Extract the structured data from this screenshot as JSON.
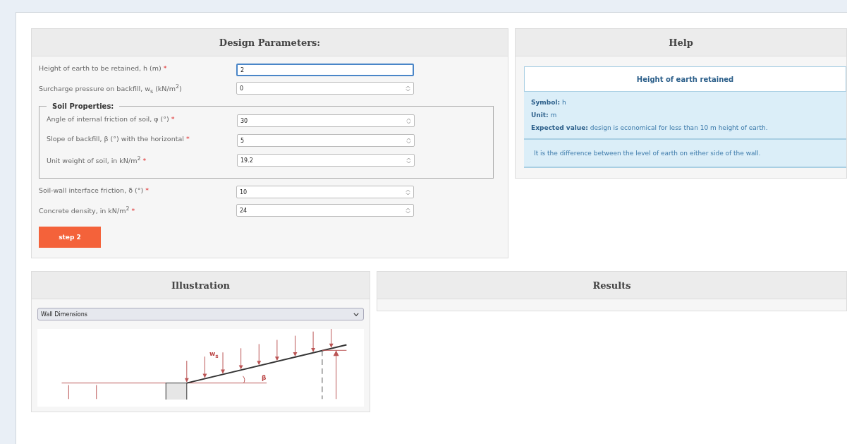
{
  "design_parameters": {
    "title": "Design Parameters:",
    "fields": [
      {
        "label": "Height of earth to be retained, h (m)",
        "mark": "*",
        "value": "2",
        "focused": true
      },
      {
        "label": "Surcharge pressure on backfill, w$_{s}$ (kN/m$^{2}$)",
        "value": "0",
        "focused": false
      }
    ],
    "soil_properties": {
      "legend": "Soil Properties:",
      "fields": [
        {
          "label": "Angle of internal friction of soil, φ (°)",
          "mark": "*",
          "value": "30",
          "focused": false
        },
        {
          "label": "Slope of backfill, β (°) with the horizontal",
          "mark": "*",
          "value": "5",
          "focused": false
        },
        {
          "label": "Unit weight of soil, in kN/m$^{2}$",
          "mark": "*",
          "value": "19.2",
          "focused": false
        }
      ]
    },
    "fields_after": [
      {
        "label": "Soil-wall interface friction, δ (°)",
        "mark": "*",
        "value": "10",
        "focused": false
      },
      {
        "label": "Concrete density, in kN/m$^{2}$",
        "mark": "*",
        "value": "24",
        "focused": false
      }
    ],
    "button": "step 2"
  },
  "help": {
    "title": "Help",
    "heading": "Height of earth retained",
    "items": [
      {
        "term": "Symbol:",
        "text": "h"
      },
      {
        "term": "Unit:",
        "text": "m"
      },
      {
        "term": "Expected value:",
        "text": "design is economical for less than 10 m height of earth."
      }
    ],
    "description": "It is the difference between the level of earth on either side of the wall."
  },
  "illustration": {
    "title": "Illustration",
    "select": "Wall Dimensions",
    "diagram_labels": {
      "surcharge": "w$_{s}$",
      "angle": "β"
    }
  },
  "results": {
    "title": "Results"
  }
}
